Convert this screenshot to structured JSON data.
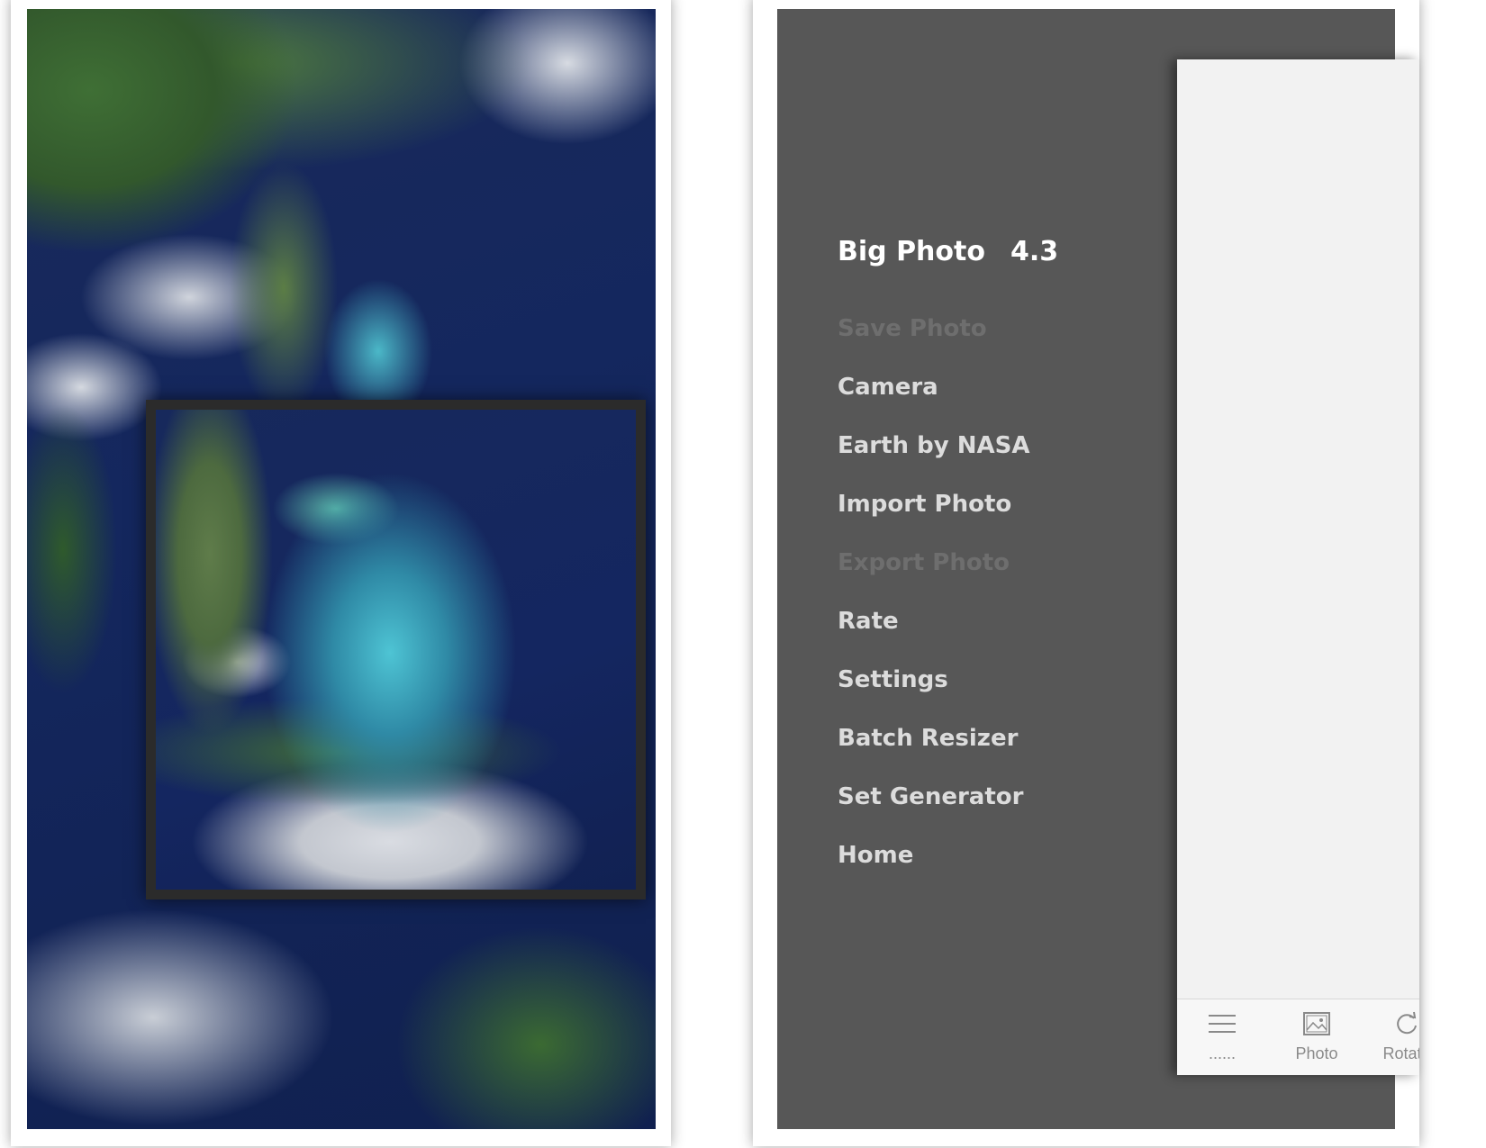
{
  "app": {
    "name": "Big Photo",
    "version": "4.3"
  },
  "menu": {
    "items": [
      {
        "label": "Save Photo",
        "enabled": false
      },
      {
        "label": "Camera",
        "enabled": true
      },
      {
        "label": "Earth by NASA",
        "enabled": true
      },
      {
        "label": "Import Photo",
        "enabled": true
      },
      {
        "label": "Export Photo",
        "enabled": false
      },
      {
        "label": "Rate",
        "enabled": true
      },
      {
        "label": "Settings",
        "enabled": true
      },
      {
        "label": "Batch Resizer",
        "enabled": true
      },
      {
        "label": "Set Generator",
        "enabled": true
      },
      {
        "label": "Home",
        "enabled": true
      }
    ]
  },
  "tab_bar": {
    "tabs": [
      {
        "label": "......",
        "icon": "hamburger-icon"
      },
      {
        "label": "Photo",
        "icon": "image-icon"
      },
      {
        "label": "Rotate",
        "icon": "rotate-icon"
      }
    ]
  },
  "colors": {
    "menu_background": "#575757",
    "menu_text": "#dcdcdc",
    "menu_text_disabled": "#6e6e6e",
    "card_background": "#f2f2f2"
  }
}
